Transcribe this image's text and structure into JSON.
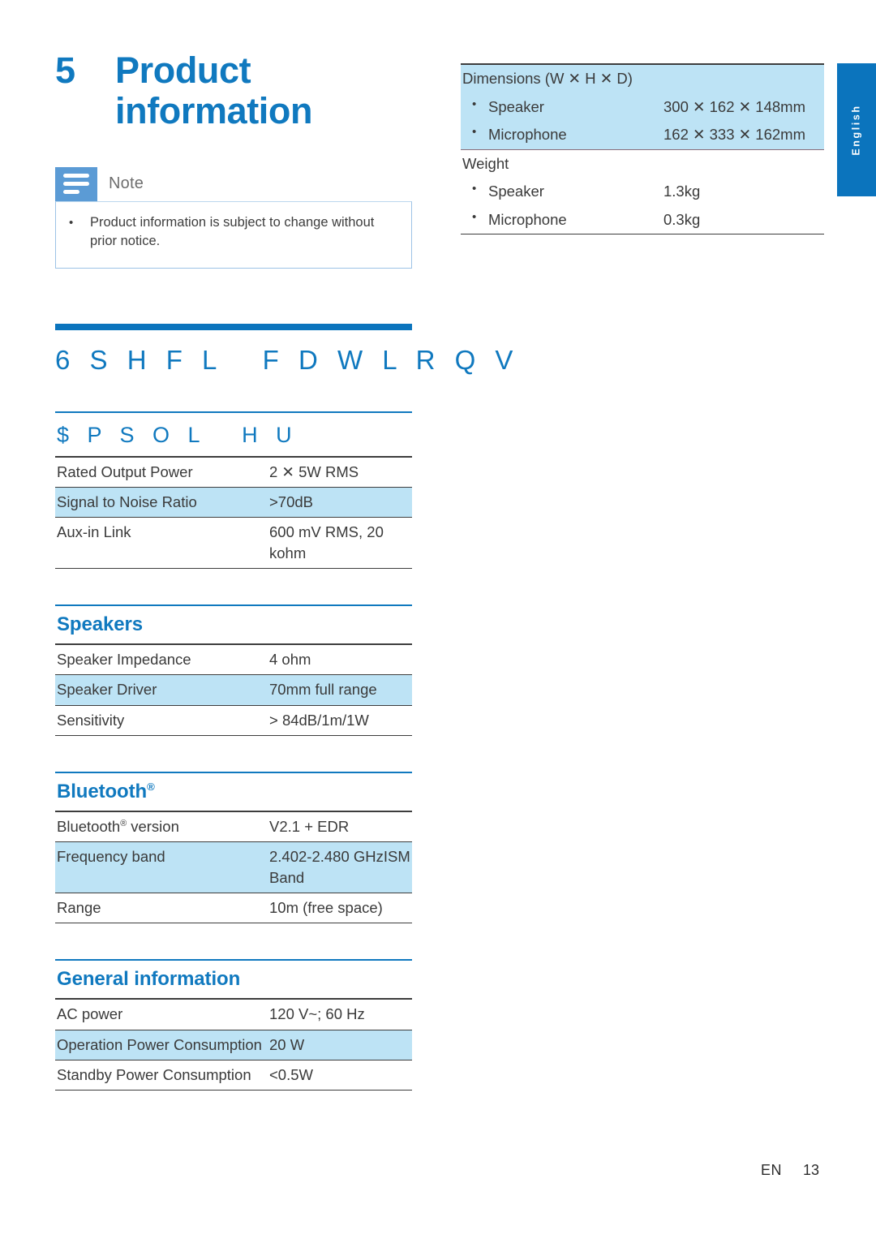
{
  "chapter": {
    "number": "5",
    "title": "Product information"
  },
  "note": {
    "icon": "note-lines-icon",
    "label": "Note",
    "bullet": "•",
    "text": "Product information is subject to change without prior notice."
  },
  "specifications": {
    "banner_title": "6 S H F L   F D W L R Q V",
    "sections": [
      {
        "id": "amplifier",
        "title": "$ P S O L   H U",
        "rows": [
          {
            "key": "Rated Output Power",
            "value": "2 ✕ 5W RMS",
            "highlight": false
          },
          {
            "key": "Signal to Noise Ratio",
            "value": ">70dB",
            "highlight": true
          },
          {
            "key": "Aux-in Link",
            "value": "600 mV RMS, 20 kohm",
            "highlight": false
          }
        ]
      },
      {
        "id": "speakers",
        "title": "Speakers",
        "rows": [
          {
            "key": "Speaker Impedance",
            "value": "4 ohm",
            "highlight": false
          },
          {
            "key": "Speaker Driver",
            "value": "70mm full range",
            "highlight": true
          },
          {
            "key": "Sensitivity",
            "value": "> 84dB/1m/1W",
            "highlight": false
          }
        ]
      },
      {
        "id": "bluetooth",
        "title": "Bluetooth",
        "title_sup": "®",
        "rows": [
          {
            "key": "Bluetooth",
            "key_sup": "®",
            "key_tail": " version",
            "value": "V2.1 + EDR",
            "highlight": false
          },
          {
            "key": "Frequency band",
            "value": "2.402-2.480 GHzISM Band",
            "highlight": true
          },
          {
            "key": "Range",
            "value": "10m (free space)",
            "highlight": false
          }
        ]
      },
      {
        "id": "general-information",
        "title": "General information",
        "rows": [
          {
            "key": "AC power",
            "value": "120 V~; 60 Hz",
            "highlight": false
          },
          {
            "key": "Operation Power Consumption",
            "value": "20 W",
            "highlight": true
          },
          {
            "key": "Standby Power Consumption",
            "value": "<0.5W",
            "highlight": false
          }
        ]
      }
    ]
  },
  "right_column": {
    "dimensions": {
      "label": "Dimensions (W ✕ H ✕ D)",
      "items": [
        {
          "bullet": "•",
          "label": "Speaker",
          "value": "300 ✕ 162 ✕ 148mm"
        },
        {
          "bullet": "•",
          "label": "Microphone",
          "value": "162 ✕ 333 ✕ 162mm"
        }
      ]
    },
    "weight": {
      "label": "Weight",
      "items": [
        {
          "bullet": "•",
          "label": "Speaker",
          "value": "1.3kg"
        },
        {
          "bullet": "•",
          "label": "Microphone",
          "value": "0.3kg"
        }
      ]
    }
  },
  "language_tab": {
    "label": "English"
  },
  "footer": {
    "locale": "EN",
    "page": "13"
  },
  "colors": {
    "heading_blue": "#1079BF",
    "banner_blue": "#0B74BD",
    "note_icon_blue": "#5B9BD5",
    "row_highlight": "#BDE3F5",
    "note_border": "#9DC3E6",
    "text": "#3a3a3a"
  }
}
